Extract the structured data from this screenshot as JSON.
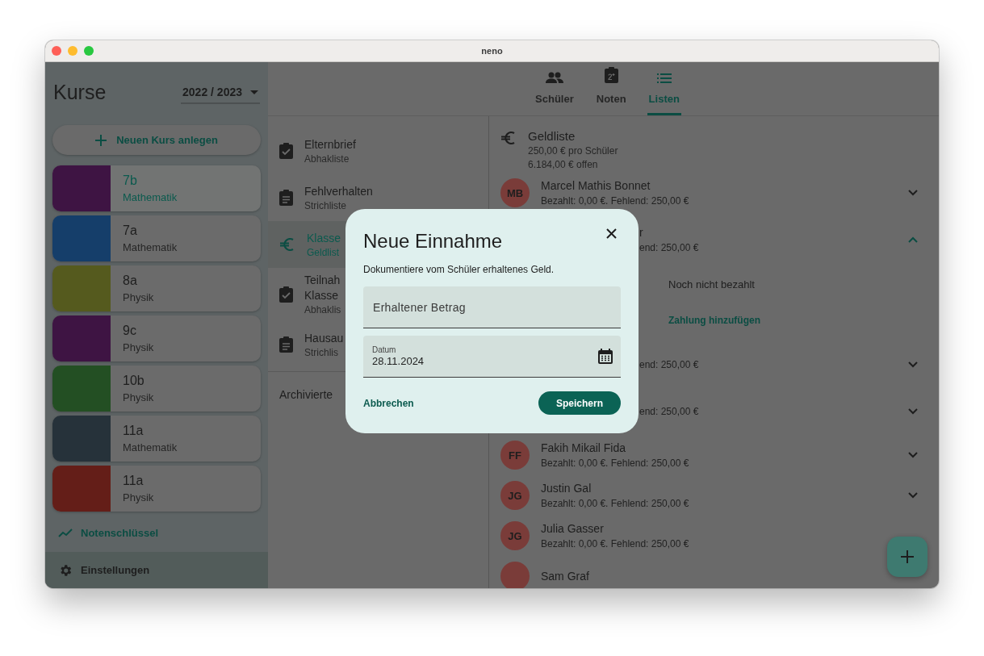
{
  "window": {
    "title": "neno"
  },
  "sidebar": {
    "title": "Kurse",
    "year": "2022 / 2023",
    "new_course_button": "Neuen Kurs anlegen",
    "courses": [
      {
        "name": "7b",
        "subject": "Mathematik",
        "color": "#3e1443",
        "selected": true
      },
      {
        "name": "7a",
        "subject": "Mathematik",
        "color": "#153e6a",
        "selected": false
      },
      {
        "name": "8a",
        "subject": "Physik",
        "color": "#555a1e",
        "selected": false
      },
      {
        "name": "9c",
        "subject": "Physik",
        "color": "#3e1443",
        "selected": false
      },
      {
        "name": "10b",
        "subject": "Physik",
        "color": "#234f23",
        "selected": false
      },
      {
        "name": "11a",
        "subject": "Mathematik",
        "color": "#26323a",
        "selected": false
      },
      {
        "name": "11a",
        "subject": "Physik",
        "color": "#641e18",
        "selected": false
      }
    ],
    "grading_key": "Notenschlüssel",
    "settings": "Einstellungen"
  },
  "tabs": [
    {
      "label": "Schüler",
      "kind": "students",
      "selected": false
    },
    {
      "label": "Noten",
      "kind": "grades",
      "selected": false
    },
    {
      "label": "Listen",
      "kind": "lists",
      "selected": true
    }
  ],
  "lists": {
    "items": [
      {
        "title": [
          "Elternbrief"
        ],
        "type": "Abhakliste",
        "kind": "checklist",
        "selected": false
      },
      {
        "title": [
          "Fehlverhalten"
        ],
        "type": "Strichliste",
        "kind": "tally",
        "selected": false
      },
      {
        "title": [
          "Klasse"
        ],
        "type": "Geldlist",
        "kind": "money",
        "selected": true
      },
      {
        "title": [
          "Teilnah",
          "Klasse"
        ],
        "type": "Abhaklis",
        "kind": "checklist",
        "selected": false
      },
      {
        "title": [
          "Hausau"
        ],
        "type": "Strichlis",
        "kind": "tally",
        "selected": false
      }
    ],
    "archived": "Archivierte"
  },
  "money_list": {
    "title": "Geldliste",
    "per_student": "250,00 € pro Schüler",
    "open": "6.184,00 € offen",
    "students": [
      {
        "kind": "student",
        "initials": "MB",
        "name": "Marcel Mathis Bonnet",
        "status": "Bezahlt: 0,00 €. Fehlend: 250,00 €",
        "expanded": false
      },
      {
        "kind": "covered",
        "name": "r",
        "status": "end: 250,00 €",
        "expanded": true,
        "details": {
          "state": "Noch nicht bezahlt",
          "add_payment": "Zahlung hinzufügen"
        }
      },
      {
        "kind": "covered",
        "status": "end: 250,00 €",
        "expanded": false
      },
      {
        "kind": "covered",
        "status": "end: 250,00 €",
        "expanded": false
      },
      {
        "kind": "student",
        "initials": "FF",
        "name": "Fakih Mikail Fida",
        "status": "Bezahlt: 0,00 €. Fehlend: 250,00 €",
        "expanded": false
      },
      {
        "kind": "student",
        "initials": "JG",
        "name": "Justin Gal",
        "status": "Bezahlt: 0,00 €. Fehlend: 250,00 €",
        "expanded": false
      },
      {
        "kind": "student",
        "initials": "JG",
        "name": "Julia Gasser",
        "status": "Bezahlt: 0,00 €. Fehlend: 250,00 €"
      },
      {
        "kind": "student",
        "name": "Sam Graf"
      }
    ]
  },
  "dialog": {
    "title": "Neue Einnahme",
    "description": "Dokumentiere vom Schüler erhaltenes Geld.",
    "amount_field": {
      "placeholder": "Erhaltener Betrag"
    },
    "date_field": {
      "label": "Datum",
      "value": "28.11.2024"
    },
    "cancel": "Abbrechen",
    "save": "Speichern"
  }
}
